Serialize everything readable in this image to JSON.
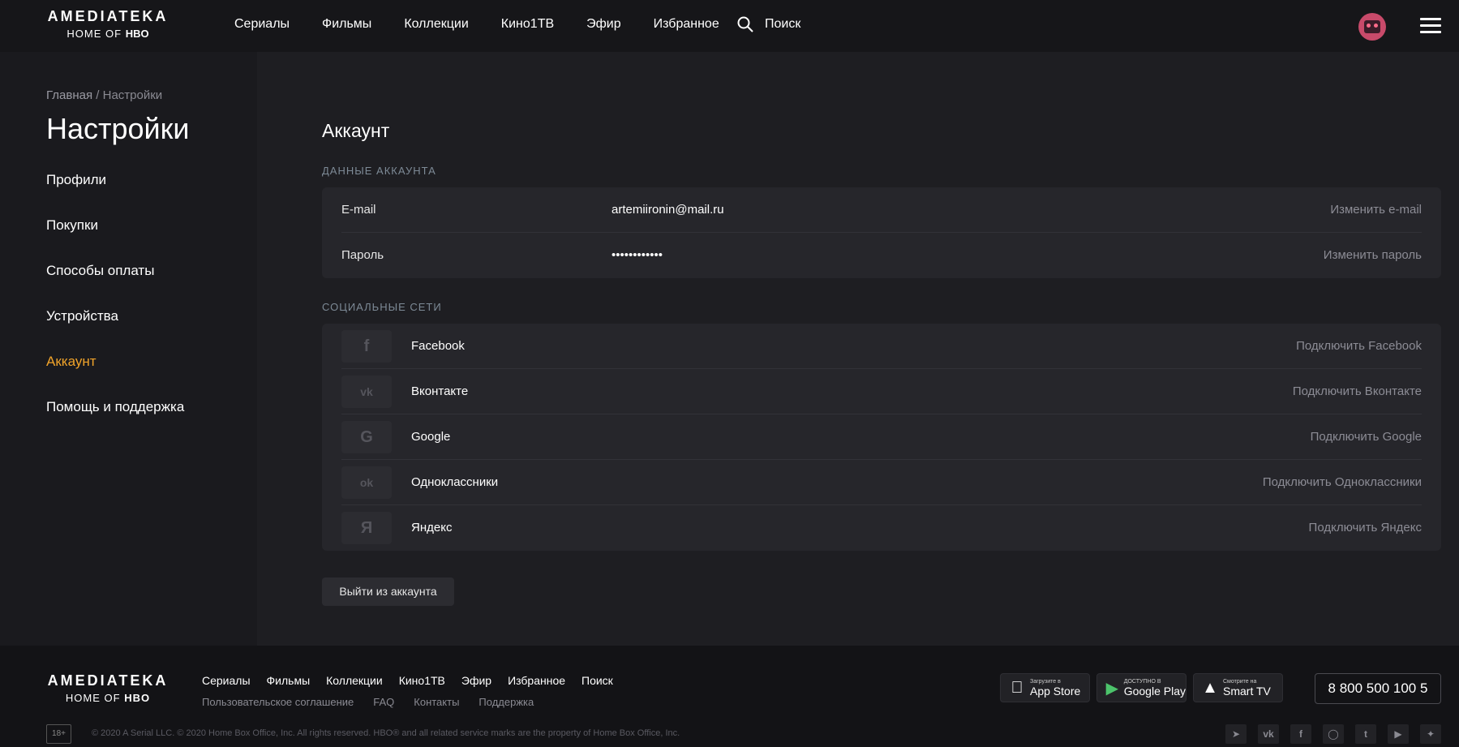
{
  "brand": {
    "logo_line1": "AMEDIATEKA",
    "logo_line2_prefix": "HOME OF",
    "logo_line2_hbo": "HBO"
  },
  "nav": {
    "items": [
      "Сериалы",
      "Фильмы",
      "Коллекции",
      "Кино1ТВ",
      "Эфир",
      "Избранное"
    ],
    "search_label": "Поиск"
  },
  "breadcrumb": {
    "home": "Главная",
    "separator": "/",
    "current": "Настройки"
  },
  "page_title": "Настройки",
  "sidebar": {
    "items": [
      "Профили",
      "Покупки",
      "Способы оплаты",
      "Устройства",
      "Аккаунт",
      "Помощь и поддержка"
    ],
    "active_index": 4
  },
  "account": {
    "title": "Аккаунт",
    "data_label": "ДАННЫЕ АККАУНТА",
    "email_label": "E-mail",
    "email_value": "artemiironin@mail.ru",
    "email_action": "Изменить e-mail",
    "password_label": "Пароль",
    "password_value": "••••••••••••",
    "password_action": "Изменить пароль"
  },
  "social": {
    "label": "СОЦИАЛЬНЫЕ СЕТИ",
    "items": [
      {
        "icon": "facebook-icon",
        "glyph": "f",
        "name": "Facebook",
        "action": "Подключить Facebook"
      },
      {
        "icon": "vk-icon",
        "glyph": "vk",
        "name": "Вконтакте",
        "action": "Подключить Вконтакте"
      },
      {
        "icon": "google-icon",
        "glyph": "G",
        "name": "Google",
        "action": "Подключить Google"
      },
      {
        "icon": "odnoklassniki-icon",
        "glyph": "ok",
        "name": "Одноклассники",
        "action": "Подключить Одноклассники"
      },
      {
        "icon": "yandex-icon",
        "glyph": "Я",
        "name": "Яндекс",
        "action": "Подключить Яндекс"
      }
    ]
  },
  "logout_label": "Выйти из аккаунта",
  "footer": {
    "links": [
      "Сериалы",
      "Фильмы",
      "Коллекции",
      "Кино1ТВ",
      "Эфир",
      "Избранное",
      "Поиск"
    ],
    "secondary_links": [
      "Пользовательское соглашение",
      "FAQ",
      "Контакты",
      "Поддержка"
    ],
    "stores": [
      {
        "icon": "apple-icon",
        "small": "Загрузите в",
        "big": "App Store"
      },
      {
        "icon": "google-play-icon",
        "small": "ДОСТУПНО В",
        "big": "Google Play"
      },
      {
        "icon": "smart-tv-icon",
        "small": "Смотрите на",
        "big": "Smart TV"
      }
    ],
    "phone": "8 800 500 100 5",
    "age_rating": "18+",
    "copyright": "© 2020 A Serial LLC. © 2020 Home Box Office, Inc. All rights reserved. HBO® and all related service marks are the property of Home Box Office, Inc.",
    "socials": [
      "telegram-icon",
      "vk-icon",
      "facebook-icon",
      "instagram-icon",
      "twitter-icon",
      "youtube-icon",
      "sparkle-icon"
    ]
  },
  "colors": {
    "accent": "#f0a32a",
    "background": "#1a1a1e",
    "card": "#26262b"
  }
}
